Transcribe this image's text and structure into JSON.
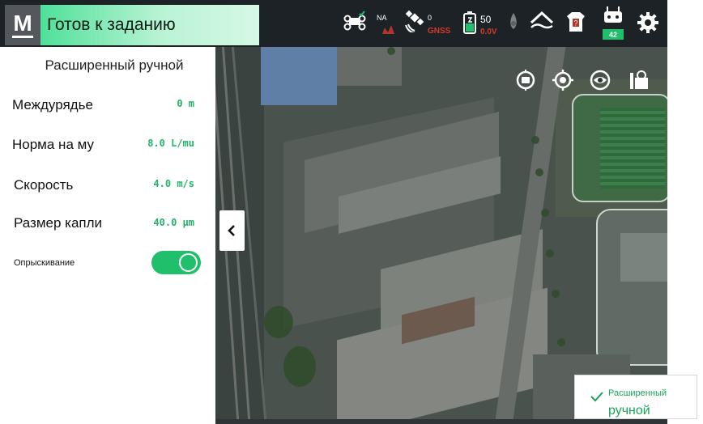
{
  "status": {
    "logo_letter": "M",
    "text": "Готов к заданию"
  },
  "topbar": {
    "rtk": {
      "label": "NA",
      "icon": "drone-rtk-icon"
    },
    "gnss": {
      "count": "0",
      "label": "GNSS",
      "icon": "satellite-icon"
    },
    "battery": {
      "percent": "50",
      "voltage": "0.0V",
      "icon": "battery-icon"
    },
    "sensor": {
      "icon": "droplet-sensor-icon"
    },
    "terrain": {
      "icon": "terrain-follow-icon"
    },
    "payload": {
      "icon": "payload-status-icon"
    },
    "remote": {
      "badge": "42",
      "icon": "remote-controller-icon"
    },
    "settings": {
      "icon": "gear-icon"
    }
  },
  "panel": {
    "title": "Расширенный ручной",
    "rows": [
      {
        "label": "Междурядье",
        "value": "0 m"
      },
      {
        "label": "Норма на му",
        "value": "8.0 L/mu"
      },
      {
        "label": "Скорость",
        "value": "4.0 m/s"
      },
      {
        "label": "Размер капли",
        "value": "40.0 µm"
      }
    ],
    "spray": {
      "label": "Опрыскивание",
      "on": true
    }
  },
  "map_tools": [
    {
      "icon": "locate-aircraft-icon"
    },
    {
      "icon": "locate-me-icon"
    },
    {
      "icon": "view-eye-icon"
    },
    {
      "icon": "map-layer-icon"
    }
  ],
  "mode_button": {
    "line1": "Расширенный",
    "line2": "ручной",
    "icon": "checkmark-icon"
  },
  "colors": {
    "accent_green": "#1fbf6b",
    "banner_green": "#4fe09a",
    "value_green": "#22b26a",
    "warning_red": "#d23a2a",
    "topbar_bg": "#1d2226"
  }
}
